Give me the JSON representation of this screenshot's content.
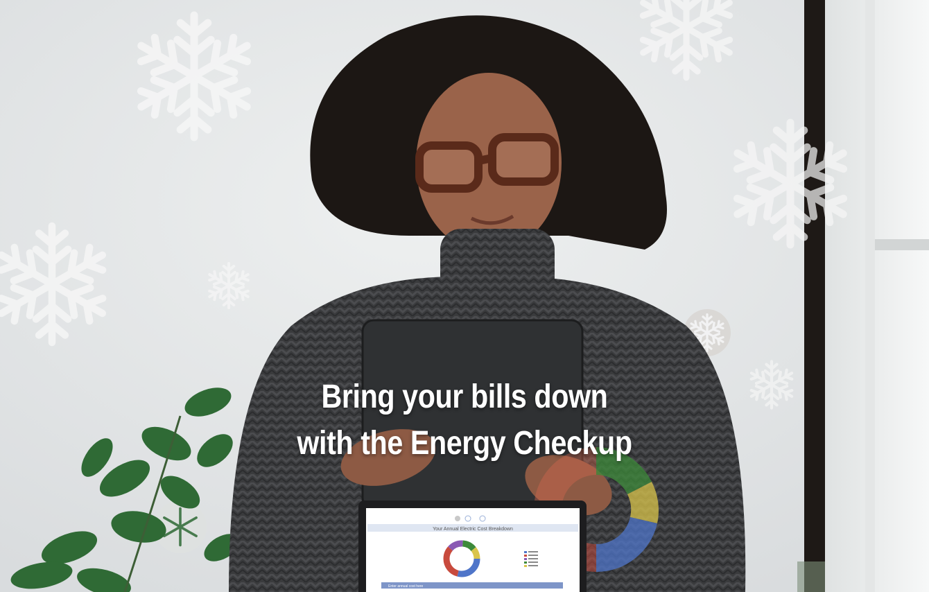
{
  "headline": {
    "line1": "Bring your bills down",
    "line2": "with the Energy Checkup"
  },
  "laptop_screen": {
    "title": "Your Annual Electric Cost Breakdown",
    "bottom_bar": "Enter annual cost here"
  },
  "colors": {
    "wall": "#e7e9ea",
    "sweater": "#3b3b3d",
    "tablet": "#303234",
    "snowflake": "#f6f6f6",
    "window_frame": "#1f1a17",
    "leaf": "#2f6a35"
  },
  "icons": [
    "snowflake-icon",
    "donut-chart-icon"
  ]
}
